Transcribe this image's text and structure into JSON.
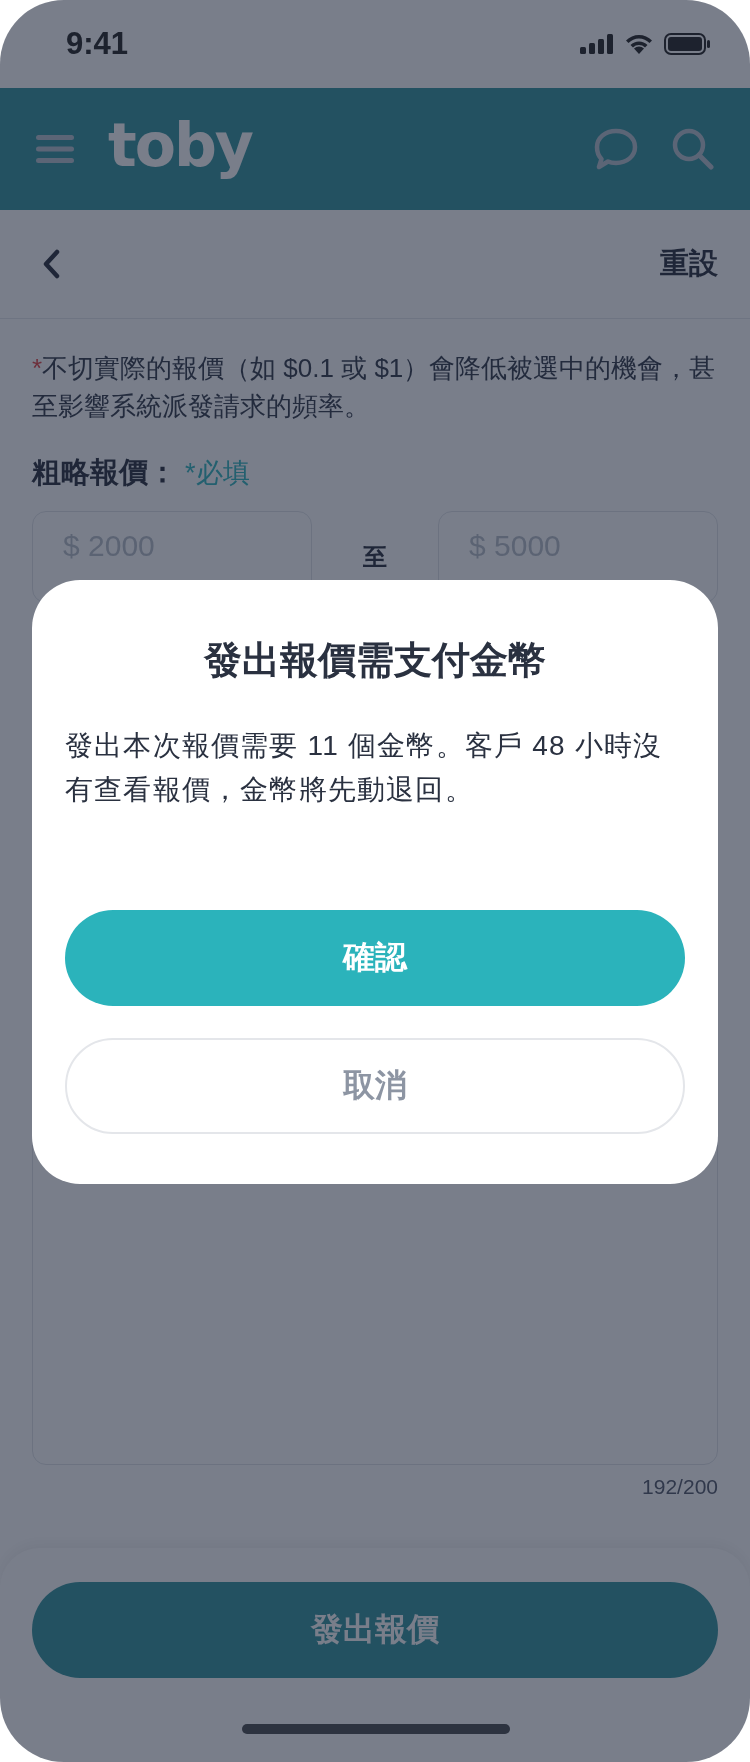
{
  "status_bar": {
    "time": "9:41"
  },
  "header": {
    "logo": "toby"
  },
  "nav": {
    "action": "重設"
  },
  "notice": {
    "asterisk": "*",
    "text": "不切實際的報價（如 $0.1 或 $1）會降低被選中的機會，甚至影響系統派發請求的頻率。"
  },
  "price": {
    "label": "粗略報價：",
    "required": "*必填",
    "min_placeholder": "$ 2000",
    "separator": "至",
    "max_placeholder": "$ 5000"
  },
  "description": {
    "counter": "192/200"
  },
  "submit_button": "發出報價",
  "dialog": {
    "title": "發出報價需支付金幣",
    "message": "發出本次報價需要 11 個金幣。客戶 48 小時沒有查看報價，金幣將先動退回。",
    "buttons": [
      {
        "label": "確認",
        "kind": "primary"
      },
      {
        "label": "取消",
        "kind": "secondary"
      }
    ]
  }
}
